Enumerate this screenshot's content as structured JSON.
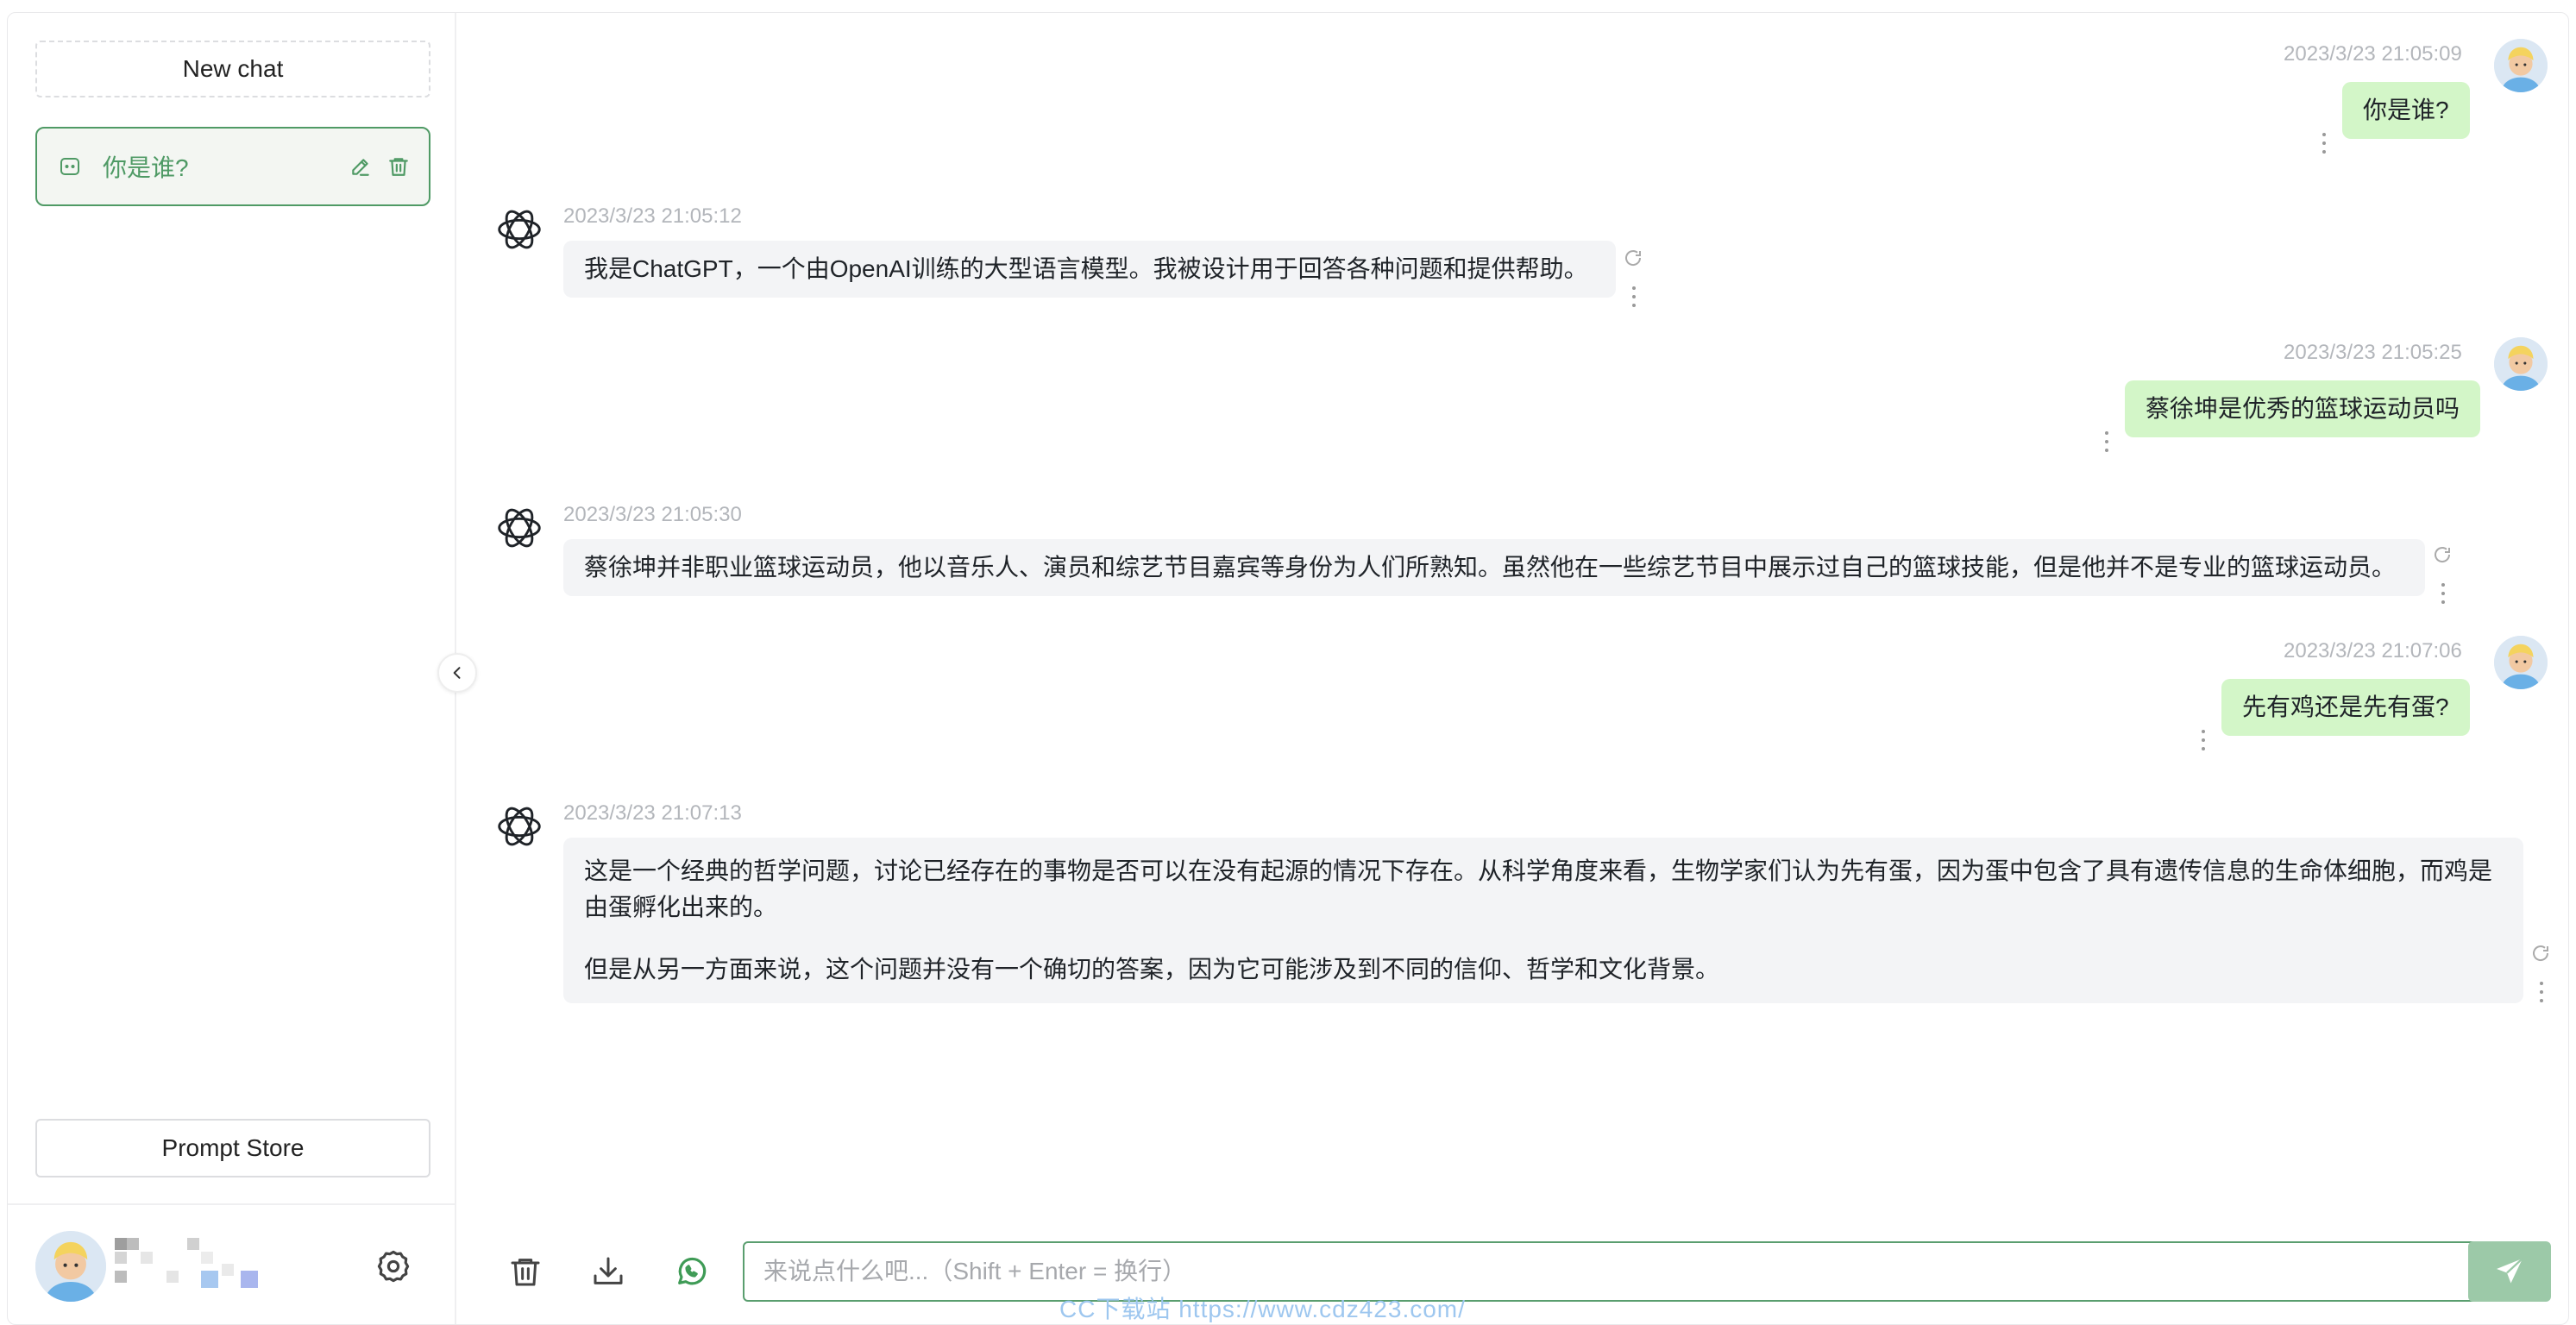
{
  "sidebar": {
    "new_chat_label": "New chat",
    "history": [
      {
        "title": "你是谁?"
      }
    ],
    "prompt_store_label": "Prompt Store"
  },
  "messages": [
    {
      "role": "user",
      "time": "2023/3/23 21:05:09",
      "text": "你是谁?"
    },
    {
      "role": "assistant",
      "time": "2023/3/23 21:05:12",
      "text": "我是ChatGPT，一个由OpenAI训练的大型语言模型。我被设计用于回答各种问题和提供帮助。"
    },
    {
      "role": "user",
      "time": "2023/3/23 21:05:25",
      "text": "蔡徐坤是优秀的篮球运动员吗"
    },
    {
      "role": "assistant",
      "time": "2023/3/23 21:05:30",
      "text": "蔡徐坤并非职业篮球运动员，他以音乐人、演员和综艺节目嘉宾等身份为人们所熟知。虽然他在一些综艺节目中展示过自己的篮球技能，但是他并不是专业的篮球运动员。"
    },
    {
      "role": "user",
      "time": "2023/3/23 21:07:06",
      "text": "先有鸡还是先有蛋?"
    },
    {
      "role": "assistant",
      "time": "2023/3/23 21:07:13",
      "paragraphs": [
        "这是一个经典的哲学问题，讨论已经存在的事物是否可以在没有起源的情况下存在。从科学角度来看，生物学家们认为先有蛋，因为蛋中包含了具有遗传信息的生命体细胞，而鸡是由蛋孵化出来的。",
        "但是从另一方面来说，这个问题并没有一个确切的答案，因为它可能涉及到不同的信仰、哲学和文化背景。"
      ]
    }
  ],
  "input": {
    "placeholder": "来说点什么吧...（Shift + Enter = 换行）",
    "value": ""
  },
  "watermark": "CC下载站 https://www.cdz423.com/",
  "icons": {
    "new_chat": "chat-icon",
    "edit": "edit-icon",
    "delete": "trash-icon",
    "settings": "gear-icon",
    "collapse": "chevron-left-icon",
    "clear": "trash-icon",
    "download": "download-icon",
    "whatsapp": "whatsapp-icon",
    "send": "send-icon",
    "more": "more-vertical-icon",
    "regenerate": "refresh-icon",
    "bot_avatar": "openai-logo-icon"
  },
  "colors": {
    "accent": "#4f9a65",
    "user_bubble": "#d3f6c8",
    "bot_bubble": "#f3f4f6",
    "send_button": "#9cc9a8"
  }
}
